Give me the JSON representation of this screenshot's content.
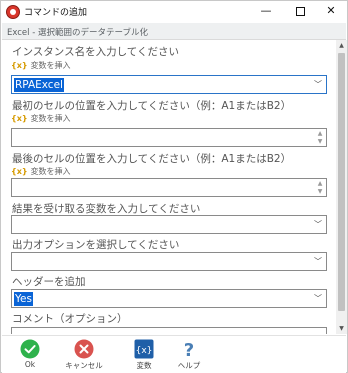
{
  "window": {
    "title": "コマンドの追加",
    "min_label": "—",
    "close_label": "✕"
  },
  "command_header": "Excel - 選択範囲のデータテーブル化",
  "variable_link_label": "変数を挿入",
  "variable_icon_text": "{x}",
  "fields": {
    "instance": {
      "label": "インスタンス名を入力してください",
      "value": "RPAExcel"
    },
    "first_cell": {
      "label": "最初のセルの位置を入力してください（例：A1またはB2）",
      "value": ""
    },
    "last_cell": {
      "label": "最後のセルの位置を入力してください（例：A1またはB2）",
      "value": ""
    },
    "result_var": {
      "label": "結果を受け取る変数を入力してください",
      "value": ""
    },
    "output_option": {
      "label": "出力オプションを選択してください",
      "value": ""
    },
    "header": {
      "label": "ヘッダーを追加",
      "value": "Yes"
    },
    "comment": {
      "label": "コメント（オプション）",
      "value": ""
    }
  },
  "footer": {
    "ok": "Ok",
    "cancel": "キャンセル",
    "variables": "変数",
    "help": "ヘルプ",
    "variables_icon": "{x}",
    "help_icon": "?"
  },
  "colors": {
    "selection": "#0a64d6",
    "ok_green": "#2fb24c",
    "cancel_red": "#d9534f",
    "var_blue": "#1f5fa8",
    "help_blue": "#4a7fb5",
    "var_link_icon": "#d69a00"
  },
  "icons": [
    "app-icon",
    "ok-icon",
    "cancel-icon",
    "variables-icon",
    "help-icon",
    "chevron-down-icon"
  ]
}
